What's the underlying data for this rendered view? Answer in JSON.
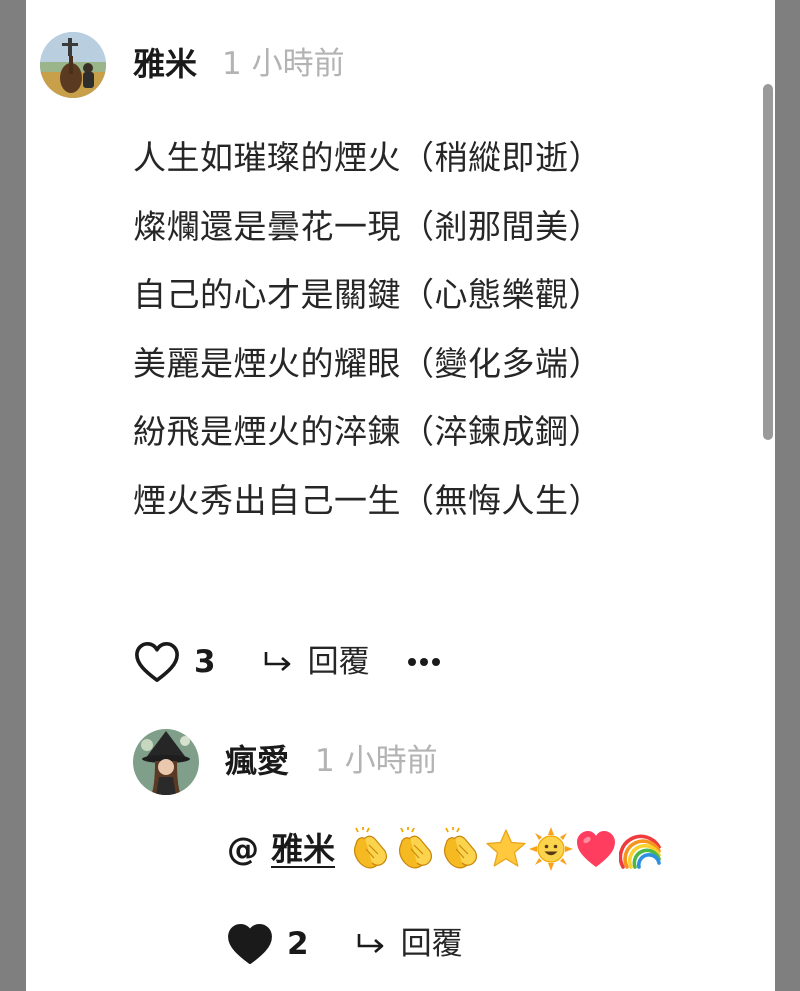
{
  "main_comment": {
    "author": "雅米",
    "time": "1 小時前",
    "lines": [
      "人生如璀璨的煙火（稍縱即逝）",
      "燦爛還是曇花一現（剎那間美）",
      "自己的心才是關鍵（心態樂觀）",
      "美麗是煙火的耀眼（變化多端）",
      "紛飛是煙火的淬鍊（淬鍊成鋼）",
      "煙火秀出自己一生（無悔人生）"
    ],
    "likes": "3",
    "liked": false,
    "reply_label": "回覆"
  },
  "reply_comment": {
    "author": "瘋愛",
    "time": "1 小時前",
    "at_symbol": "@",
    "mention": "雅米",
    "emojis": [
      "clap-emoji",
      "clap-emoji",
      "clap-emoji",
      "star-emoji",
      "sun-emoji",
      "heart-emoji",
      "rainbow-emoji"
    ],
    "likes": "2",
    "liked": true,
    "reply_label": "回覆"
  },
  "colors": {
    "text": "#1a1a1a",
    "muted": "#b3b3b3",
    "background": "#ffffff",
    "frame": "#7f7f7f"
  }
}
